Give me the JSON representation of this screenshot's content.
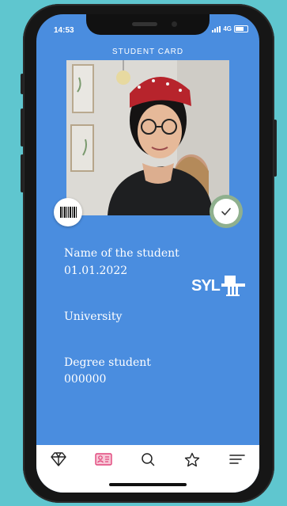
{
  "status_bar": {
    "time": "14:53",
    "network": "4G"
  },
  "header": {
    "title": "STUDENT CARD"
  },
  "student": {
    "name": "Name of the student",
    "date": "01.01.2022",
    "university": "University",
    "degree": "Degree student",
    "number": "000000"
  },
  "logo": {
    "text": "SYL"
  },
  "colors": {
    "card_background": "#4a8ddf",
    "verified_ring": "#8fb08e",
    "active_nav": "#e0457b",
    "frame_background": "#5fc6cf"
  },
  "nav": {
    "items": [
      {
        "icon": "diamond-icon"
      },
      {
        "icon": "id-card-icon",
        "active": true
      },
      {
        "icon": "search-icon"
      },
      {
        "icon": "star-icon"
      },
      {
        "icon": "menu-icon"
      }
    ]
  }
}
